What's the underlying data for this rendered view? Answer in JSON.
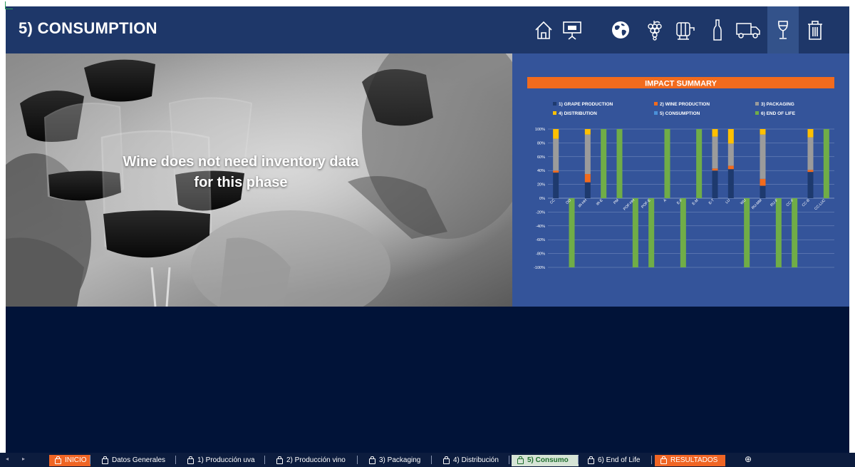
{
  "header": {
    "title": "5) CONSUMPTION"
  },
  "nav_icons": [
    "home-icon",
    "presentation-icon",
    "globe-icon",
    "grapes-icon",
    "barrel-icon",
    "bottle-icon",
    "truck-icon",
    "wine-glass-icon",
    "trash-icon"
  ],
  "photo": {
    "line1": "Wine does not need inventory data",
    "line2": "for this phase"
  },
  "chart_data": {
    "type": "bar",
    "stacked": true,
    "title": "IMPACT SUMMARY",
    "legend_position": "top",
    "ylim": [
      -100,
      100
    ],
    "y_ticks": [
      "100%",
      "80%",
      "60%",
      "40%",
      "20%",
      "0%",
      "-20%",
      "-40%",
      "-60%",
      "-80%",
      "-100%"
    ],
    "y_tick_values": [
      100,
      80,
      60,
      40,
      20,
      0,
      -20,
      -40,
      -60,
      -80,
      -100
    ],
    "categories": [
      "CC",
      "OD",
      "IR-HH",
      "IR-E",
      "PM",
      "POF-HH",
      "POF-E",
      "A",
      "E-F",
      "E-M",
      "E-T",
      "LU",
      "WU",
      "RU-MM",
      "RU-F",
      "CC-F",
      "CC-B",
      "CC-LUC"
    ],
    "series": [
      {
        "name": "1) GRAPE PRODUCTION",
        "color": "#1e3a6e",
        "values": [
          37,
          0,
          23,
          0,
          0,
          0,
          0,
          0,
          0,
          0,
          40,
          42,
          0,
          18,
          0,
          0,
          38,
          0
        ]
      },
      {
        "name": "2) WINE PRODUCTION",
        "color": "#f26b1d",
        "values": [
          3,
          0,
          12,
          0,
          0,
          0,
          0,
          0,
          0,
          0,
          3,
          5,
          0,
          10,
          0,
          0,
          3,
          0
        ]
      },
      {
        "name": "3) PACKAGING",
        "color": "#9b9b9b",
        "values": [
          46,
          0,
          57,
          0,
          0,
          0,
          0,
          0,
          0,
          0,
          46,
          32,
          0,
          64,
          0,
          0,
          47,
          0
        ]
      },
      {
        "name": "4) DISTRIBUTION",
        "color": "#ffc000",
        "values": [
          14,
          0,
          8,
          0,
          0,
          0,
          0,
          0,
          0,
          0,
          11,
          21,
          0,
          8,
          0,
          0,
          12,
          0
        ]
      },
      {
        "name": "5) CONSUMPTION",
        "color": "#4a90d9",
        "values": [
          0,
          0,
          0,
          0,
          0,
          0,
          0,
          0,
          0,
          0,
          0,
          0,
          0,
          0,
          0,
          0,
          0,
          0
        ]
      },
      {
        "name": "6) END OF LIFE",
        "color": "#70ad47",
        "values": [
          0,
          -100,
          0,
          100,
          100,
          -100,
          -100,
          100,
          -100,
          100,
          0,
          0,
          -100,
          0,
          -100,
          -100,
          0,
          100
        ]
      }
    ]
  },
  "sheet_tabs": {
    "items": [
      {
        "label": "INICIO"
      },
      {
        "label": "Datos Generales"
      },
      {
        "label": "1) Producción uva"
      },
      {
        "label": "2) Producción vino"
      },
      {
        "label": "3) Packaging"
      },
      {
        "label": "4) Distribución"
      },
      {
        "label": "5) Consumo"
      },
      {
        "label": "6) End of Life"
      },
      {
        "label": "RESULTADOS"
      }
    ],
    "add_label": "⊕",
    "prev_label": "◂",
    "next_label": "▸"
  }
}
